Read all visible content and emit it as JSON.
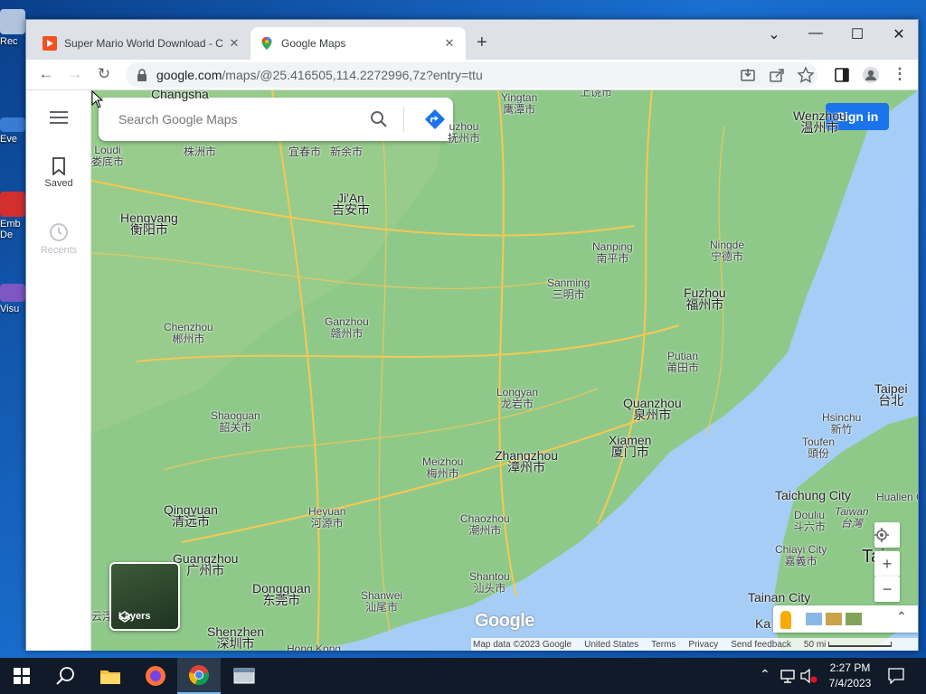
{
  "desktop": {
    "icons": [
      {
        "label": "Rec",
        "color": "#b0c4de"
      },
      {
        "label": "Eve",
        "color": "#3a7bd5"
      },
      {
        "label": "Emb De",
        "color": "#d32f2f"
      },
      {
        "label": "Visu",
        "color": "#7e57c2"
      }
    ]
  },
  "browser": {
    "tabs": [
      {
        "title": "Super Mario World Download - C",
        "active": false
      },
      {
        "title": "Google Maps",
        "active": true
      }
    ],
    "new_tab": "+",
    "window_controls": {
      "menu": "⌄",
      "minimize": "—",
      "maximize": "☐",
      "close": "✕"
    },
    "url_host": "google.com",
    "url_path": "/maps/@25.416505,114.2272996,7z?entry=ttu"
  },
  "maps": {
    "nav": {
      "menu_icon": "menu-icon",
      "saved_label": "Saved",
      "recents_label": "Recents"
    },
    "search_placeholder": "Search Google Maps",
    "sign_in_label": "Sign in",
    "layers_label": "Layers",
    "google_logo": "Google",
    "footer": {
      "map_data": "Map data ©2023 Google",
      "region": "United States",
      "terms": "Terms",
      "privacy": "Privacy",
      "feedback": "Send feedback",
      "scale": "50 mi"
    },
    "places": [
      {
        "en": "Changsha",
        "cn": ""
      },
      {
        "en": "Yingtan",
        "cn": "鹰潭市"
      },
      {
        "en": "上饶市",
        "cn": ""
      },
      {
        "en": "uzhou",
        "cn": "抚州市"
      },
      {
        "en": "Wenzhou",
        "cn": "温州市"
      },
      {
        "en": "Loudi",
        "cn": "娄底市"
      },
      {
        "en": "株洲市",
        "cn": ""
      },
      {
        "en": "宜春市",
        "cn": ""
      },
      {
        "en": "新余市",
        "cn": ""
      },
      {
        "en": "Ji'An",
        "cn": "吉安市"
      },
      {
        "en": "Hengyang",
        "cn": "衡阳市"
      },
      {
        "en": "Nanping",
        "cn": "南平市"
      },
      {
        "en": "Ningde",
        "cn": "宁德市"
      },
      {
        "en": "Sanming",
        "cn": "三明市"
      },
      {
        "en": "Fuzhou",
        "cn": "福州市"
      },
      {
        "en": "Chenzhou",
        "cn": "郴州市"
      },
      {
        "en": "Ganzhou",
        "cn": "赣州市"
      },
      {
        "en": "Putian",
        "cn": "莆田市"
      },
      {
        "en": "Longyan",
        "cn": "龙岩市"
      },
      {
        "en": "Quanzhou",
        "cn": "泉州市"
      },
      {
        "en": "Taipei",
        "cn": "台北"
      },
      {
        "en": "Shaoguan",
        "cn": "韶关市"
      },
      {
        "en": "Hsinchu",
        "cn": "新竹"
      },
      {
        "en": "Xiamen",
        "cn": "厦门市"
      },
      {
        "en": "Meizhou",
        "cn": "梅州市"
      },
      {
        "en": "Zhangzhou",
        "cn": "漳州市"
      },
      {
        "en": "Toufen",
        "cn": "頭份"
      },
      {
        "en": "Qingyuan",
        "cn": "清远市"
      },
      {
        "en": "Heyuan",
        "cn": "河源市"
      },
      {
        "en": "Chaozhou",
        "cn": "潮州市"
      },
      {
        "en": "Taichung City",
        "cn": ""
      },
      {
        "en": "Hualien County",
        "cn": ""
      },
      {
        "en": "Douliu",
        "cn": "斗六市"
      },
      {
        "en": "Taiwan",
        "cn": "台灣"
      },
      {
        "en": "Guangzhou",
        "cn": "广州市"
      },
      {
        "en": "Dongguan",
        "cn": "东莞市"
      },
      {
        "en": "Shantou",
        "cn": "汕头市"
      },
      {
        "en": "Chiayi City",
        "cn": "嘉義市"
      },
      {
        "en": "Taiw",
        "cn": ""
      },
      {
        "en": "Shanwei",
        "cn": "汕尾市"
      },
      {
        "en": "Tainan City",
        "cn": ""
      },
      {
        "en": "Shenzhen",
        "cn": "深圳市"
      },
      {
        "en": "云浮",
        "cn": ""
      },
      {
        "en": "Hong Kong",
        "cn": ""
      },
      {
        "en": "Ka",
        "cn": ""
      }
    ]
  },
  "taskbar": {
    "time": "2:27 PM",
    "date": "7/4/2023"
  },
  "colors": {
    "land": "#8fc98a",
    "land_light": "#a9d49c",
    "sea": "#a5cdf5",
    "road": "#f6c851",
    "accent": "#1a73e8"
  }
}
